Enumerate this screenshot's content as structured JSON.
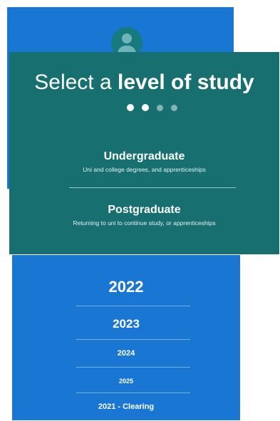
{
  "header": {
    "avatar_icon": "account-circle-icon"
  },
  "level_picker": {
    "title_light": "Select a ",
    "title_bold": "level of study",
    "step_indicator": {
      "total": 4,
      "active": 2
    },
    "options": [
      {
        "label": "Undergraduate",
        "description": "Uni and college degrees, and apprenticeships"
      },
      {
        "label": "Postgraduate",
        "description": "Returning to uni to continue study, or apprenticeships"
      }
    ]
  },
  "year_picker": {
    "years": [
      "2022",
      "2023",
      "2024",
      "2025",
      "2021 - Clearing"
    ],
    "selected": "2022"
  },
  "colors": {
    "blue_background": "#1976d2",
    "teal_panel": "#176f70",
    "text": "#ffffff"
  }
}
